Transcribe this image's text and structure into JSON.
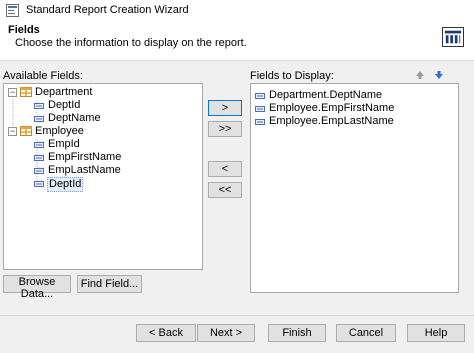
{
  "window": {
    "title": "Standard Report Creation Wizard",
    "app_icon": "wizard-icon"
  },
  "header": {
    "title": "Fields",
    "description": "Choose the information to display on the report.",
    "icon": "report-columns-icon"
  },
  "available_fields": {
    "label": "Available Fields:",
    "tree": [
      {
        "label": "Department",
        "type": "table",
        "expanded": true,
        "children": [
          {
            "label": "DeptId"
          },
          {
            "label": "DeptName"
          }
        ]
      },
      {
        "label": "Employee",
        "type": "table",
        "expanded": true,
        "children": [
          {
            "label": "EmpId"
          },
          {
            "label": "EmpFirstName"
          },
          {
            "label": "EmpLastName"
          },
          {
            "label": "DeptId",
            "selected": true
          }
        ]
      }
    ]
  },
  "move_buttons": {
    "add": ">",
    "add_all": ">>",
    "remove": "<",
    "remove_all": "<<"
  },
  "fields_to_display": {
    "label": "Fields to Display:",
    "items": [
      "Department.DeptName",
      "Employee.EmpFirstName",
      "Employee.EmpLastName"
    ],
    "move_up_icon": "arrow-up-icon",
    "move_down_icon": "arrow-down-icon"
  },
  "left_buttons": {
    "browse": "Browse Data...",
    "find": "Find Field..."
  },
  "footer_buttons": {
    "back": "< Back",
    "next": "Next >",
    "finish": "Finish",
    "cancel": "Cancel",
    "help": "Help"
  },
  "colors": {
    "accent": "#0078d7",
    "move_up": "#9a9a9a",
    "move_down": "#2f6fd6"
  }
}
